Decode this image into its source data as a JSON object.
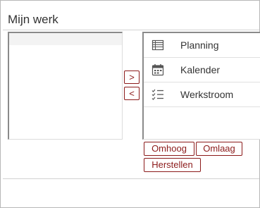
{
  "panel": {
    "title": "Mijn werk"
  },
  "available_list": {
    "items": []
  },
  "move_buttons": {
    "add_label": ">",
    "remove_label": "<"
  },
  "selected_list": {
    "items": [
      {
        "label": "Planning",
        "icon": "table-list-icon"
      },
      {
        "label": "Kalender",
        "icon": "calendar-icon"
      },
      {
        "label": "Werkstroom",
        "icon": "checklist-icon"
      }
    ]
  },
  "actions": {
    "up_label": "Omhoog",
    "down_label": "Omlaag",
    "reset_label": "Herstellen"
  },
  "colors": {
    "accent": "#8b1a1a",
    "text": "#333333",
    "icon": "#555555"
  }
}
